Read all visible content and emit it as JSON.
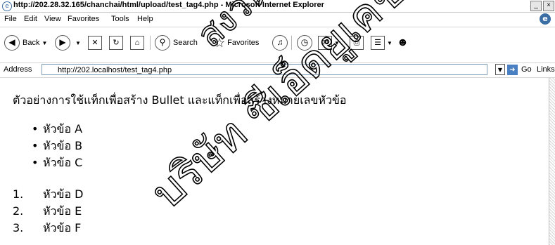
{
  "window": {
    "title": "http://202.28.32.165/chanchai/html/upload/test_tag4.php - Microsoft Internet Explorer",
    "controls": [
      "_",
      "×"
    ]
  },
  "menu": [
    "File",
    "Edit",
    "View",
    "Favorites",
    "Tools",
    "Help"
  ],
  "toolbar": {
    "back_label": "Back",
    "search_label": "Search",
    "favorites_label": "Favorites"
  },
  "address": {
    "label": "Address",
    "url": "http://202.localhost/test_tag4.php",
    "go_label": "Go",
    "links_label": "Links"
  },
  "page": {
    "heading": "ตัวอย่างการใช้แท็กเพื่อสร้าง Bullet และแท็กเพื่อสร้างหมายเลขหัวข้อ",
    "bullets": [
      "หัวข้อ A",
      "หัวข้อ B",
      "หัวข้อ C"
    ],
    "numbered": [
      {
        "n": "1.",
        "text": "หัวข้อ D"
      },
      {
        "n": "2.",
        "text": "หัวข้อ E"
      },
      {
        "n": "3.",
        "text": "หัวข้อ F"
      }
    ]
  },
  "watermark": {
    "text_1": "บริษัท ซีเอ็ดยูเคชั่น",
    "text_2": "สงวนลิขสิทธิ์",
    "color": "#000000"
  }
}
